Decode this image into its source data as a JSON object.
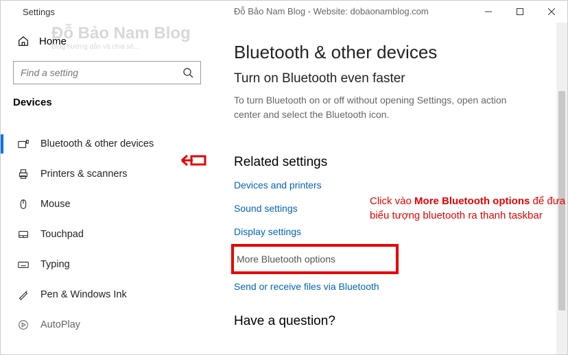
{
  "titlebar": {
    "back_aria": "Back",
    "title": "Settings",
    "center_text": "Đỗ Bảo Nam Blog - Website: dobaonamblog.com"
  },
  "sidebar": {
    "home": "Home",
    "search_placeholder": "Find a setting",
    "section": "Devices",
    "items": [
      {
        "label": "Bluetooth & other devices",
        "icon": "bluetooth",
        "active": true
      },
      {
        "label": "Printers & scanners",
        "icon": "printer"
      },
      {
        "label": "Mouse",
        "icon": "mouse"
      },
      {
        "label": "Touchpad",
        "icon": "touchpad"
      },
      {
        "label": "Typing",
        "icon": "typing"
      },
      {
        "label": "Pen & Windows Ink",
        "icon": "pen"
      },
      {
        "label": "AutoPlay",
        "icon": "autoplay"
      }
    ]
  },
  "content": {
    "title": "Bluetooth & other devices",
    "subhead": "Turn on Bluetooth even faster",
    "desc": "To turn Bluetooth on or off without opening Settings, open action center and select the Bluetooth icon.",
    "related_title": "Related settings",
    "links": {
      "devices": "Devices and printers",
      "sound": "Sound settings",
      "display": "Display settings",
      "more_bt": "More Bluetooth options",
      "send": "Send or receive files via Bluetooth"
    },
    "question": "Have a question?"
  },
  "annotation": {
    "pre": "Click vào ",
    "bold": "More Bluetooth options",
    "post": " để đưa biểu tượng bluetooth ra thanh taskbar"
  },
  "watermark": {
    "big": "Đỗ Bảo Nam Blog",
    "sm": "Blog hướng dẫn và chia sẻ..."
  }
}
